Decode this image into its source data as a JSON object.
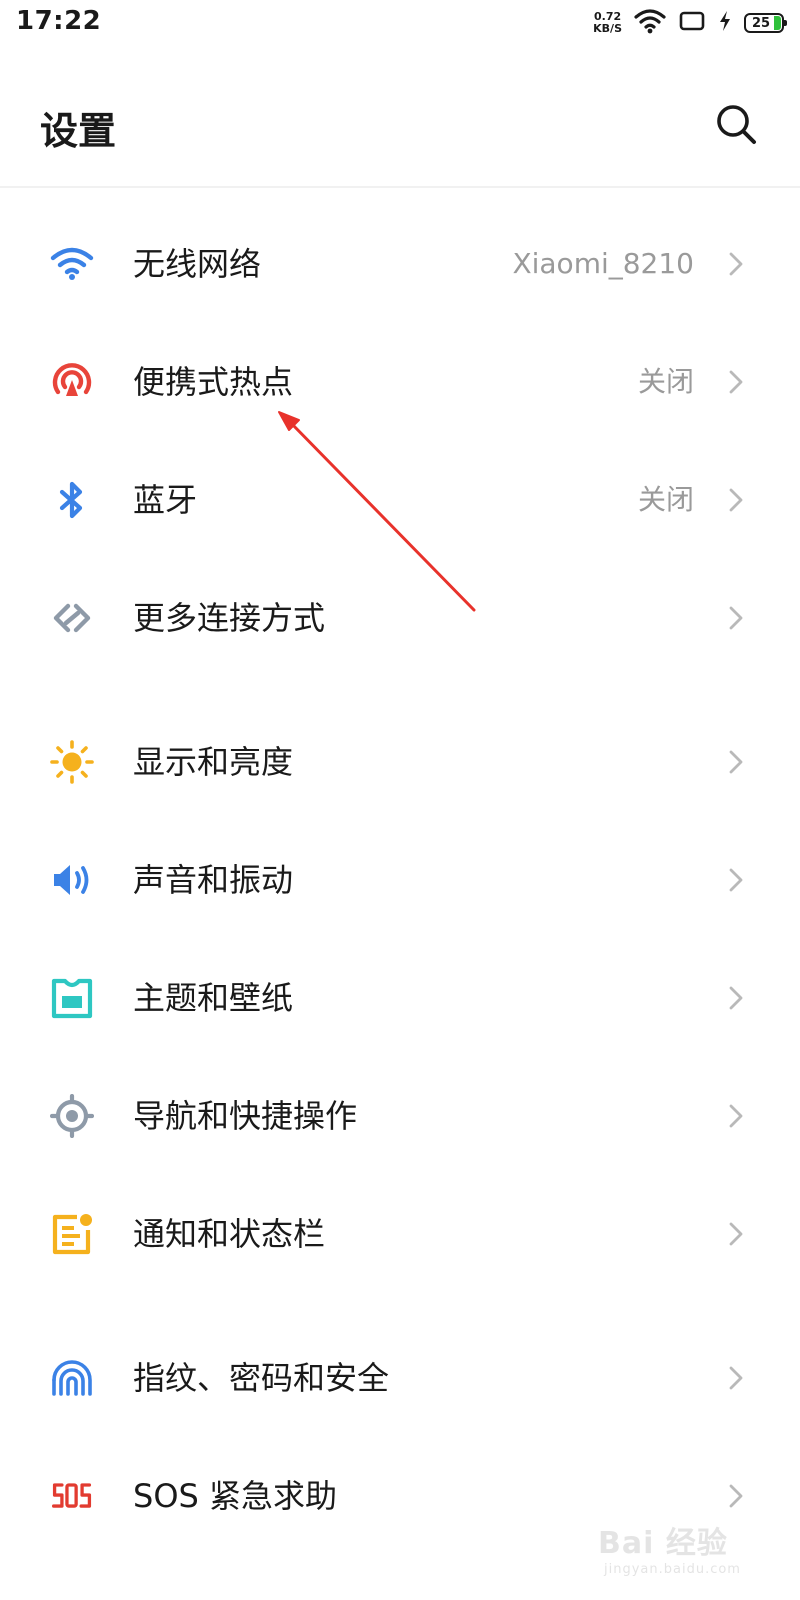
{
  "status_bar": {
    "time": "17:22",
    "net_speed_value": "0.72",
    "net_speed_unit": "KB/S",
    "battery_level": "25",
    "icons": [
      "wifi-icon",
      "screen-rotate-icon",
      "charging-icon",
      "battery-icon"
    ]
  },
  "header": {
    "title": "设置",
    "search_icon": "search-icon"
  },
  "items": [
    {
      "label": "无线网络",
      "value": "Xiaomi_8210",
      "icon": "wifi-icon",
      "color": "#3b82e6"
    },
    {
      "label": "便携式热点",
      "value": "关闭",
      "icon": "hotspot-icon",
      "color": "#e8443a"
    },
    {
      "label": "蓝牙",
      "value": "关闭",
      "icon": "bluetooth-icon",
      "color": "#3b82e6"
    },
    {
      "label": "更多连接方式",
      "value": "",
      "icon": "more-connections-icon",
      "color": "#8e9aa8"
    },
    {
      "label": "显示和亮度",
      "value": "",
      "icon": "brightness-icon",
      "color": "#f5b11d"
    },
    {
      "label": "声音和振动",
      "value": "",
      "icon": "sound-icon",
      "color": "#3b82e6"
    },
    {
      "label": "主题和壁纸",
      "value": "",
      "icon": "theme-icon",
      "color": "#2ec7c2"
    },
    {
      "label": "导航和快捷操作",
      "value": "",
      "icon": "navigation-icon",
      "color": "#8e9aa8"
    },
    {
      "label": "通知和状态栏",
      "value": "",
      "icon": "notification-icon",
      "color": "#f5b11d"
    },
    {
      "label": "指纹、密码和安全",
      "value": "",
      "icon": "fingerprint-icon",
      "color": "#3b82e6"
    },
    {
      "label": "SOS 紧急求助",
      "value": "",
      "icon": "sos-icon",
      "color": "#e23b30"
    }
  ],
  "watermark": {
    "brand": "Bai 经验",
    "site": "jingyan.baidu.com"
  },
  "annotation": {
    "color": "#e8322b"
  }
}
